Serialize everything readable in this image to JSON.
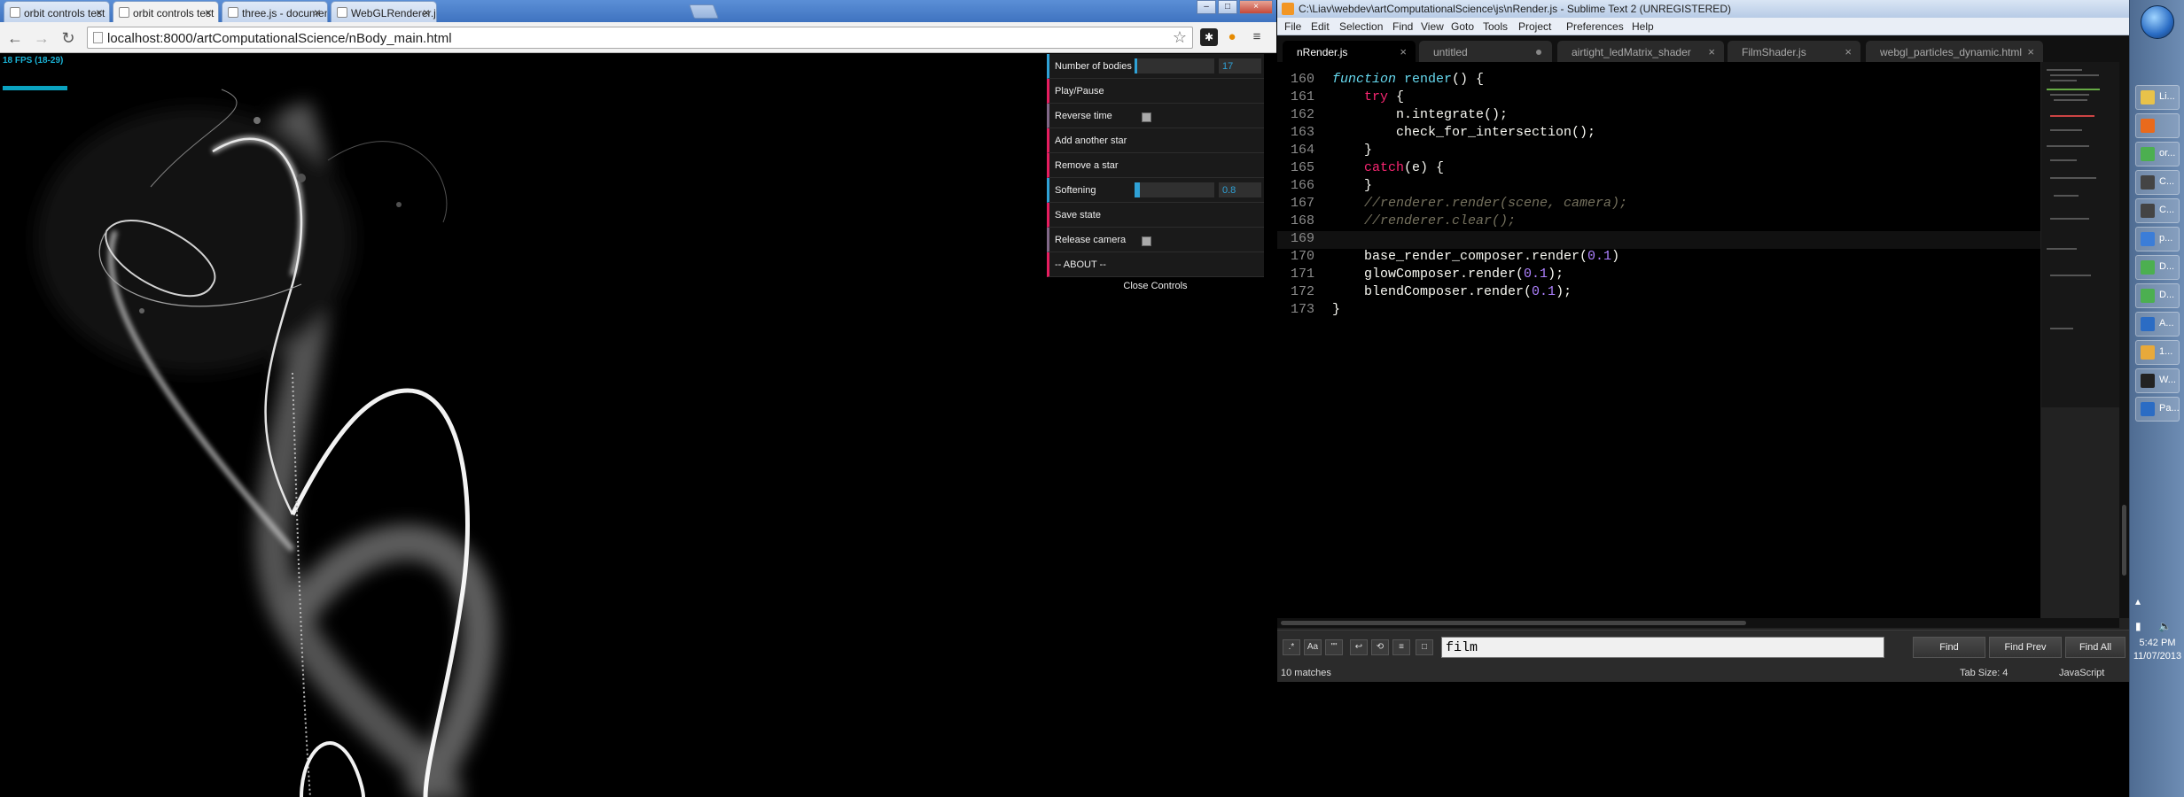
{
  "browser": {
    "tabs": [
      {
        "title": "orbit controls test",
        "active": false
      },
      {
        "title": "orbit controls test",
        "active": true
      },
      {
        "title": "three.js - documentation",
        "active": false
      },
      {
        "title": "WebGLRenderer.js",
        "active": false
      }
    ],
    "url": "localhost:8000/artComputationalScience/nBody_main.html",
    "nav": {
      "back_icon": "back-arrow-icon",
      "forward_icon": "forward-arrow-icon",
      "reload_icon": "reload-icon"
    },
    "page": {
      "fps_text": "18 FPS (18-29)",
      "gui": {
        "rows": [
          {
            "label": "Number of bodies",
            "type": "slider",
            "value": "17",
            "fill_fraction": 0.03
          },
          {
            "label": "Play/Pause",
            "type": "function"
          },
          {
            "label": "Reverse time",
            "type": "boolean"
          },
          {
            "label": "Add another star",
            "type": "function"
          },
          {
            "label": "Remove a star",
            "type": "function"
          },
          {
            "label": "Softening",
            "type": "slider",
            "value": "0.8",
            "fill_fraction": 0.07
          },
          {
            "label": "Save state",
            "type": "function"
          },
          {
            "label": "Release camera",
            "type": "boolean"
          },
          {
            "label": "-- ABOUT --",
            "type": "function"
          }
        ],
        "close_label": "Close Controls"
      }
    }
  },
  "sublime": {
    "title": "C:\\Liav\\webdev\\artComputationalScience\\js\\nRender.js - Sublime Text 2 (UNREGISTERED)",
    "menu": [
      "File",
      "Edit",
      "Selection",
      "Find",
      "View",
      "Goto",
      "Tools",
      "Project",
      "Preferences",
      "Help"
    ],
    "tabs": [
      {
        "title": "nRender.js",
        "active": true,
        "dirty": false
      },
      {
        "title": "untitled",
        "active": false,
        "dirty": true
      },
      {
        "title": "airtight_ledMatrix_shader",
        "active": false,
        "dirty": false
      },
      {
        "title": "FilmShader.js",
        "active": false,
        "dirty": false
      },
      {
        "title": "webgl_particles_dynamic.html",
        "active": false,
        "dirty": false
      }
    ],
    "code": [
      {
        "n": "160",
        "text": "function render() {"
      },
      {
        "n": "161",
        "text": "    try {"
      },
      {
        "n": "162",
        "text": "        n.integrate();"
      },
      {
        "n": "163",
        "text": "        check_for_intersection();"
      },
      {
        "n": "164",
        "text": "    }"
      },
      {
        "n": "165",
        "text": "    catch(e) {"
      },
      {
        "n": "166",
        "text": "    }"
      },
      {
        "n": "167",
        "text": "    //renderer.render(scene, camera);"
      },
      {
        "n": "168",
        "text": "    //renderer.clear();"
      },
      {
        "n": "169",
        "text": ""
      },
      {
        "n": "170",
        "text": "    base_render_composer.render(0.1)"
      },
      {
        "n": "171",
        "text": "    glowComposer.render(0.1);"
      },
      {
        "n": "172",
        "text": "    blendComposer.render(0.1);"
      },
      {
        "n": "173",
        "text": "}"
      }
    ],
    "find": {
      "value": "film",
      "buttons": [
        "Find",
        "Find Prev",
        "Find All"
      ],
      "toggles": [
        ".*",
        "Aa",
        "\"\""
      ]
    },
    "status": {
      "matches": "10 matches",
      "tab_size": "Tab Size: 4",
      "syntax": "JavaScript"
    }
  },
  "taskbar": {
    "items": [
      {
        "label": "Li...",
        "color": "#e8c24a"
      },
      {
        "label": "",
        "color": "#e96a1c"
      },
      {
        "label": "or...",
        "color": "#4caf50"
      },
      {
        "label": "C...",
        "color": "#444444"
      },
      {
        "label": "C...",
        "color": "#444444"
      },
      {
        "label": "p...",
        "color": "#3b7dd8"
      },
      {
        "label": "D...",
        "color": "#4caf50"
      },
      {
        "label": "D...",
        "color": "#4caf50"
      },
      {
        "label": "A...",
        "color": "#2b6cc4"
      },
      {
        "label": "1...",
        "color": "#e8a93a"
      },
      {
        "label": "W...",
        "color": "#222222"
      },
      {
        "label": "Pa...",
        "color": "#2b6cc4"
      }
    ],
    "time": "5:42 PM",
    "date": "11/07/2013"
  },
  "colors": {
    "gui_number_accent": "#2fa1d6",
    "gui_function_accent": "#e61d5f",
    "fps_text": "#1ab3d6"
  }
}
